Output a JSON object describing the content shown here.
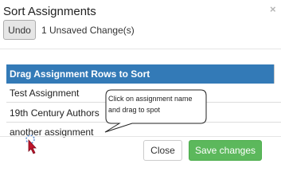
{
  "dialog": {
    "title": "Sort Assignments",
    "close_icon": "×"
  },
  "toolbar": {
    "undo_label": "Undo",
    "unsaved_text": "1 Unsaved Change(s)"
  },
  "list": {
    "header": "Drag Assignment Rows to Sort",
    "rows": [
      "Test Assignment",
      "19th Century Authors",
      "another assignment"
    ]
  },
  "tooltip": {
    "text": "Click on assignment name and drag to spot"
  },
  "footer": {
    "close_label": "Close",
    "save_label": "Save changes"
  },
  "colors": {
    "header_bg": "#337ab7",
    "save_bg": "#5cb85c",
    "cursor": "#c0142c"
  },
  "icons": [
    "close-icon",
    "move-cursor-icon"
  ]
}
